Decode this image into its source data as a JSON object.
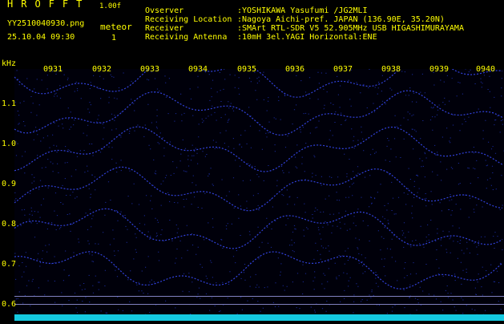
{
  "app": {
    "title": "HROFFT",
    "version": "1.00f",
    "file_name": "YY2510040930.png",
    "timestamp": "25.10.04 09:30",
    "event_label": "meteor",
    "event_count": "1"
  },
  "info": {
    "observer_key": "Ovserver",
    "observer_val": ":YOSHIKAWA Yasufumi /JG2MLI",
    "location_key": "Receiving Location",
    "location_val": ":Nagoya Aichi-pref. JAPAN (136.90E, 35.20N)",
    "receiver_key": "Receiver",
    "receiver_val": ":SMArt RTL-SDR V5 52.905MHz USB HIGASHIMURAYAMA",
    "antenna_key": "Receiving Antenna",
    "antenna_val": ":10mH 3el.YAGI Horizontal:ENE"
  },
  "axis": {
    "y_unit": "kHz",
    "y_ticks": [
      "1.1",
      "1.0",
      "0.9",
      "0.8",
      "0.7",
      "0.6"
    ],
    "x_ticks": [
      "0931",
      "0932",
      "0933",
      "0934",
      "0935",
      "0936",
      "0937",
      "0938",
      "0939",
      "0940"
    ]
  },
  "colors": {
    "text": "#ffff00",
    "trace": "#3a4cff",
    "baseline": "#14c9e0",
    "reference_line": "#8080c0"
  }
}
